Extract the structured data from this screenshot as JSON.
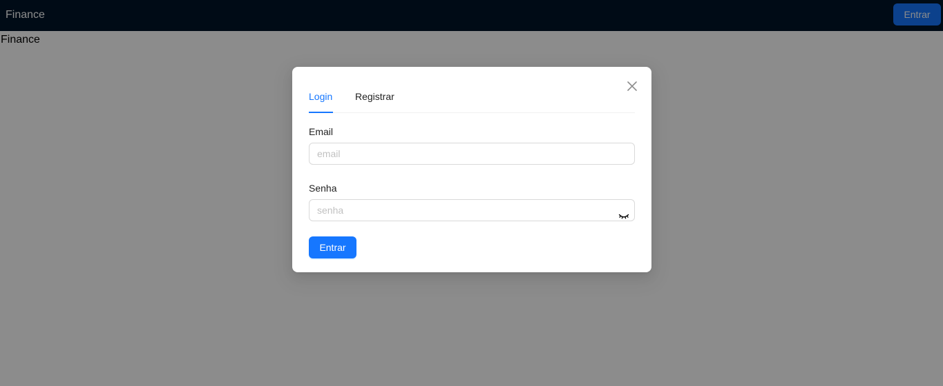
{
  "navbar": {
    "brand": "Finance",
    "login_button": "Entrar"
  },
  "page": {
    "heading": "Finance"
  },
  "modal": {
    "close_icon": "close-icon",
    "tabs": [
      {
        "label": "Login",
        "active": true
      },
      {
        "label": "Registrar",
        "active": false
      }
    ],
    "email": {
      "label": "Email",
      "placeholder": "email",
      "value": ""
    },
    "password": {
      "label": "Senha",
      "placeholder": "senha",
      "value": "",
      "toggle_icon": "eye-invisible-icon"
    },
    "submit_label": "Entrar"
  },
  "colors": {
    "navbar_bg": "#001529",
    "primary": "#1677ff",
    "mask": "rgba(0,0,0,0.45)"
  }
}
